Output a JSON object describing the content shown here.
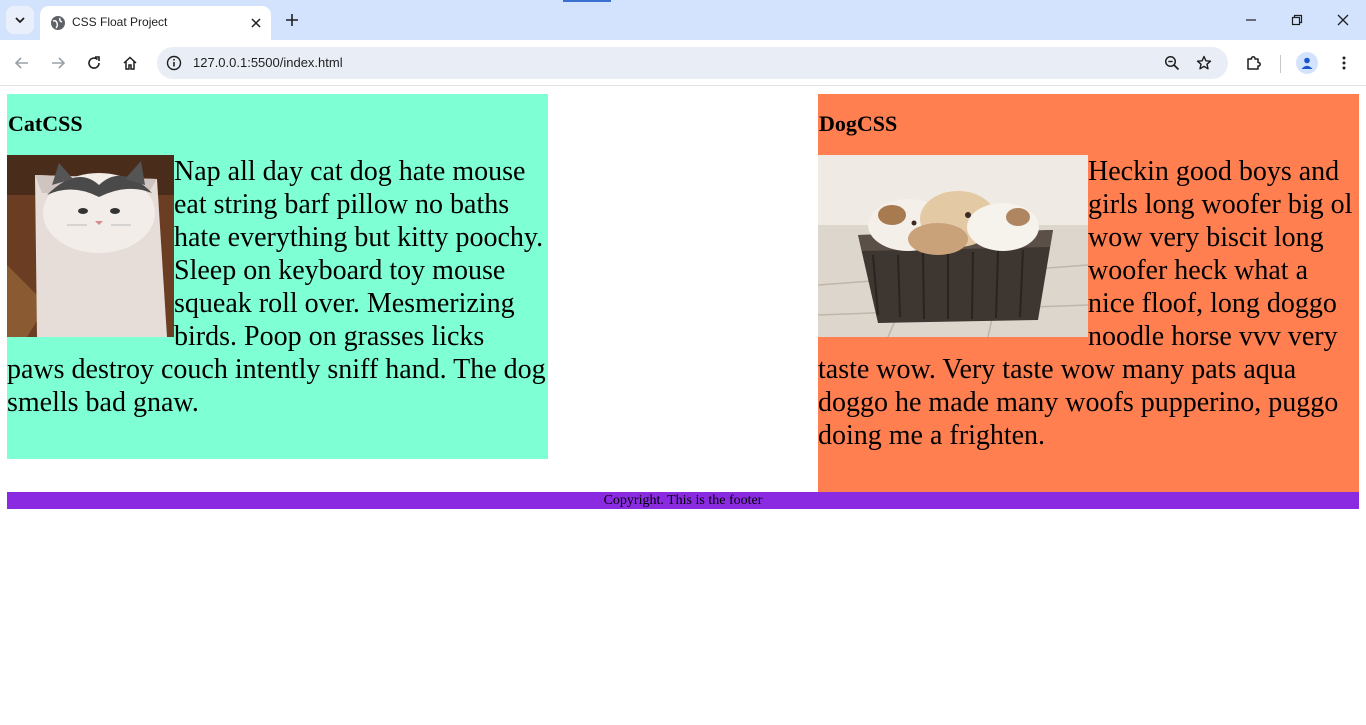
{
  "browser": {
    "tab": {
      "title": "CSS Float Project"
    },
    "address_bar": {
      "url": "127.0.0.1:5500/index.html"
    }
  },
  "page": {
    "cat_section": {
      "heading": "CatCSS",
      "text": "Nap all day cat dog hate mouse eat string barf pillow no baths hate everything but kitty poochy. Sleep on keyboard toy mouse squeak roll over. Mesmerizing birds. Poop on grasses licks paws destroy couch intently sniff hand. The dog smells bad gnaw.",
      "background": "#7fffd4"
    },
    "dog_section": {
      "heading": "DogCSS",
      "text": "Heckin good boys and girls long woofer big ol wow very biscit long woofer heck what a nice floof, long doggo noodle horse vvv very taste wow. Very taste wow many pats aqua doggo he made many woofs pupperino, puggo doing me a frighten.",
      "background": "#ff7f50"
    },
    "footer": {
      "text": "Copyright. This is the footer",
      "background": "#8a2be2"
    }
  }
}
